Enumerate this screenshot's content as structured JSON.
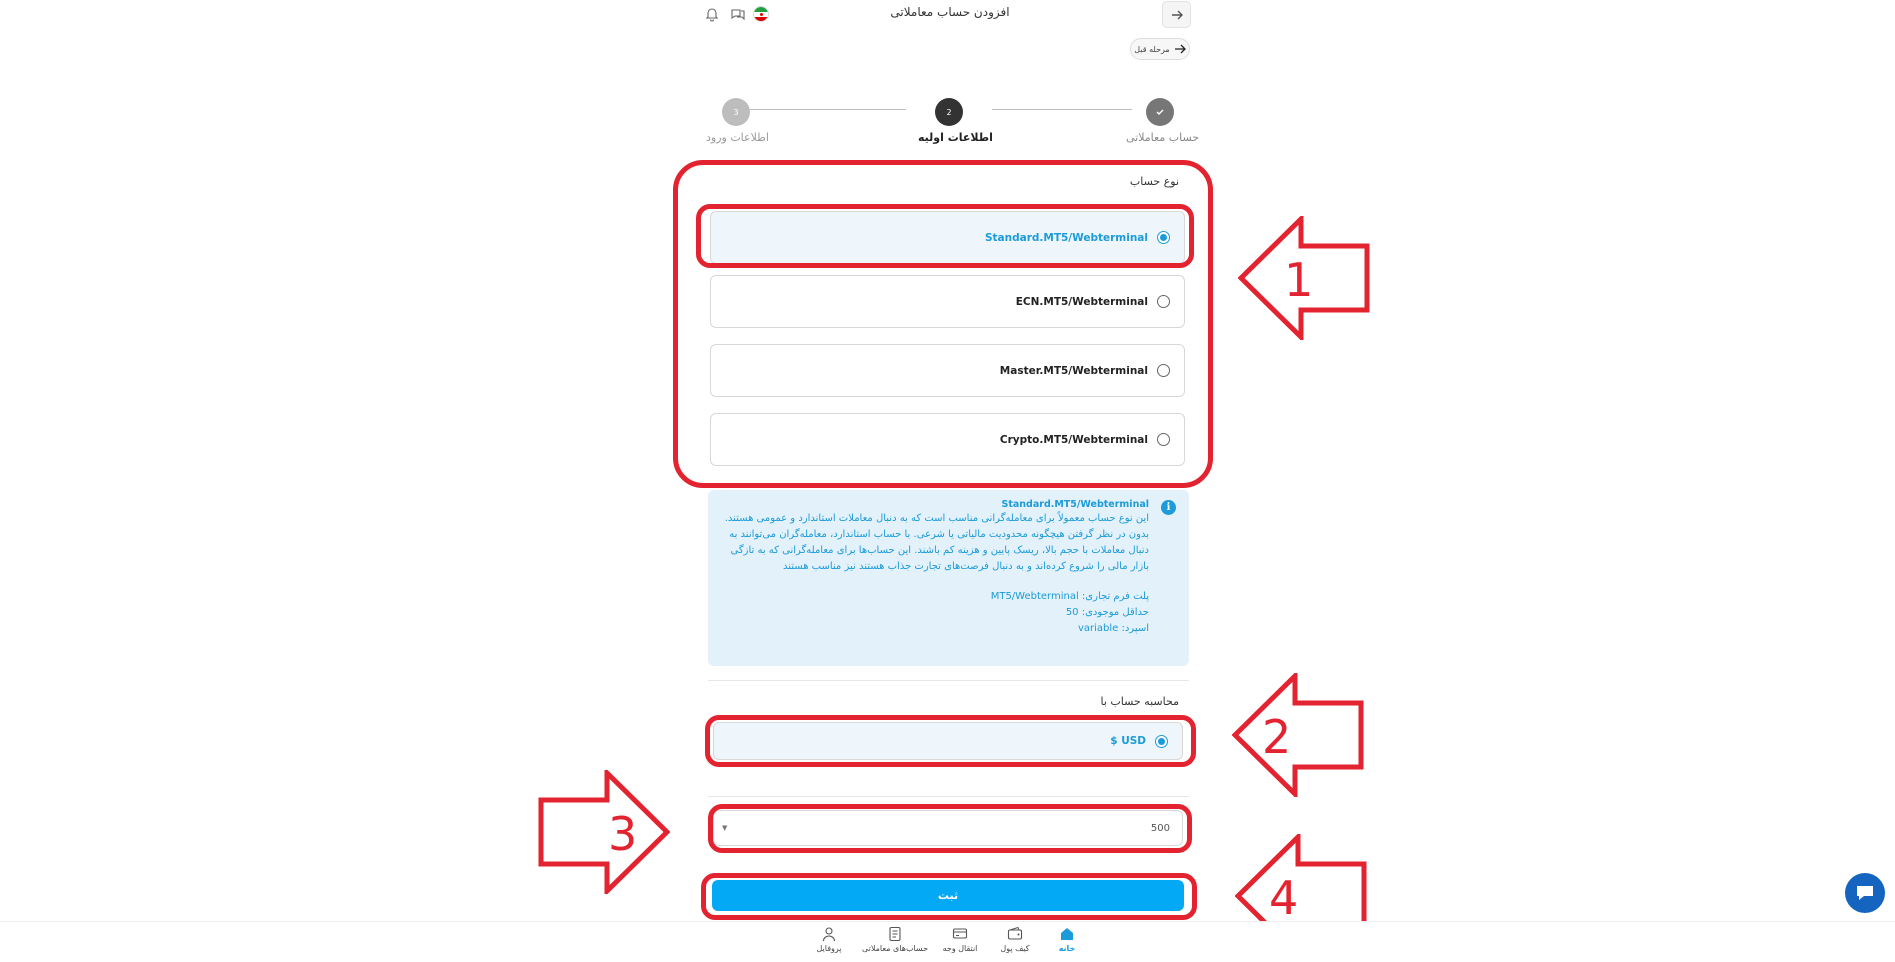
{
  "header": {
    "title": "افزودن حساب معاملاتی",
    "prev_step_label": "مرحله قبل"
  },
  "stepper": {
    "steps": [
      {
        "number": "",
        "label": "حساب معاملاتی",
        "state": "done"
      },
      {
        "number": "2",
        "label": "اطلاعات اولیه",
        "state": "current"
      },
      {
        "number": "3",
        "label": "اطلاعات ورود",
        "state": "upcoming"
      }
    ]
  },
  "account_type": {
    "title": "نوع حساب",
    "options": [
      {
        "label": "Standard.MT5/Webterminal",
        "selected": true
      },
      {
        "label": "ECN.MT5/Webterminal",
        "selected": false
      },
      {
        "label": "Master.MT5/Webterminal",
        "selected": false
      },
      {
        "label": "Crypto.MT5/Webterminal",
        "selected": false
      }
    ]
  },
  "info": {
    "title": "Standard.MT5/Webterminal",
    "description": "این نوع حساب معمولاً برای معامله‌گرانی مناسب است که به دنبال معاملات استاندارد و عمومی هستند. بدون در نظر گرفتن هیچگونه محدودیت مالیاتی یا شرعی. با حساب استاندارد، معامله‌گران می‌توانند به دنبال معاملات با حجم بالا، ریسک پایین و هزینه کم باشند. این حساب‌ها برای معامله‌گرانی که به تازگی بازار مالی را شروع کرده‌اند و به دنبال فرصت‌های تجارت جذاب هستند نیز مناسب هستند",
    "platform": "پلت فرم تجاری: MT5/Webterminal",
    "min_balance": "حداقل موجودی: 50",
    "spread": "اسپرد: variable"
  },
  "currency": {
    "title": "محاسبه حساب با",
    "option_label": "$ USD",
    "selected": true
  },
  "amount": {
    "value": "500"
  },
  "submit_label": "ثبت",
  "annotations": [
    "1",
    "2",
    "3",
    "4"
  ],
  "bottom_nav": {
    "items": [
      {
        "label": "پروفایل",
        "icon": "user-icon",
        "active": false
      },
      {
        "label": "حساب‌های معاملاتی",
        "icon": "document-icon",
        "active": false
      },
      {
        "label": "انتقال وجه",
        "icon": "transfer-icon",
        "active": false
      },
      {
        "label": "کیف پول",
        "icon": "wallet-icon",
        "active": false
      },
      {
        "label": "خانه",
        "icon": "home-icon",
        "active": true
      }
    ]
  },
  "colors": {
    "accent": "#1b9bd9",
    "primary_button": "#03a9f4",
    "annotation_red": "#e3232f",
    "step_done": "#777777",
    "step_current": "#333333",
    "step_upcoming": "#bdbdbd"
  }
}
